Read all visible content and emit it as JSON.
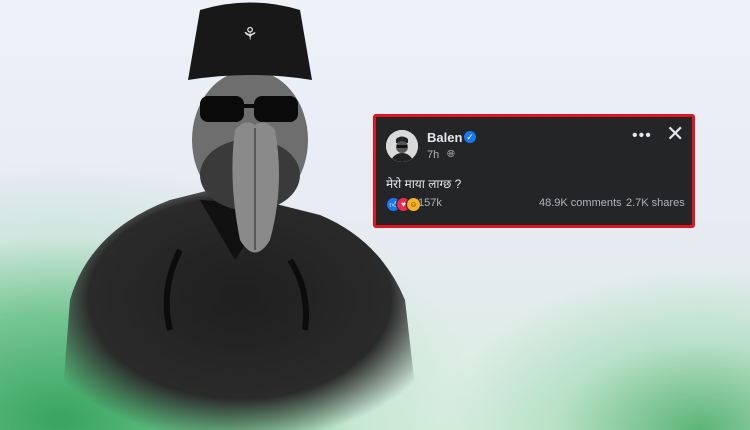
{
  "post": {
    "author": "Balen",
    "time": "7h",
    "text": "मेरो माया लाग्छ ?",
    "reaction_count": "157k",
    "comments": "48.9K comments",
    "shares": "2.7K shares"
  },
  "icons": {
    "verified": "verified-badge-icon",
    "audience": "globe-icon",
    "more": "more-options-icon",
    "close": "close-icon",
    "reactions": [
      "like-icon",
      "love-icon",
      "haha-icon"
    ]
  },
  "colors": {
    "card_bg": "#242526",
    "card_border": "#e0141c",
    "accent": "#1877f2",
    "green_glow": "#2ea05a"
  }
}
